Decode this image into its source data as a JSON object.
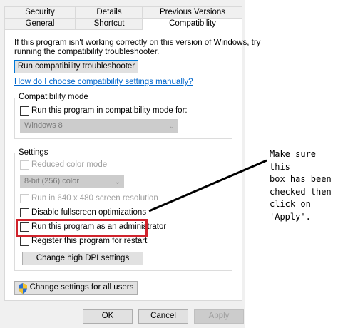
{
  "tabs": {
    "row1": [
      {
        "label": "Security"
      },
      {
        "label": "Details"
      },
      {
        "label": "Previous Versions"
      }
    ],
    "row2": [
      {
        "label": "General"
      },
      {
        "label": "Shortcut"
      },
      {
        "label": "Compatibility"
      }
    ]
  },
  "intro": {
    "line1": "If this program isn't working correctly on this version of Windows, try",
    "line2": "running the compatibility troubleshooter."
  },
  "troubleshooter_button": "Run compatibility troubleshooter",
  "manual_link": "How do I choose compatibility settings manually?",
  "compat_mode": {
    "group_label": "Compatibility mode",
    "checkbox_label": "Run this program in compatibility mode for:",
    "selected_os": "Windows 8"
  },
  "settings": {
    "group_label": "Settings",
    "reduced_color": "Reduced color mode",
    "color_select": "8-bit (256) color",
    "run_640": "Run in 640 x 480 screen resolution",
    "disable_fullscreen": "Disable fullscreen optimizations",
    "run_admin": "Run this program as an administrator",
    "register_restart": "Register this program for restart",
    "high_dpi_button": "Change high DPI settings"
  },
  "change_all_button": "Change settings for all users",
  "footer": {
    "ok": "OK",
    "cancel": "Cancel",
    "apply": "Apply"
  },
  "annotation": "Make sure this\nbox has been\nchecked then\nclick on 'Apply'.",
  "colors": {
    "highlight_border": "#d0232c",
    "link": "#0066cc",
    "focus_border": "#0078d7"
  },
  "icons": {
    "shield": "uac-shield-icon"
  }
}
